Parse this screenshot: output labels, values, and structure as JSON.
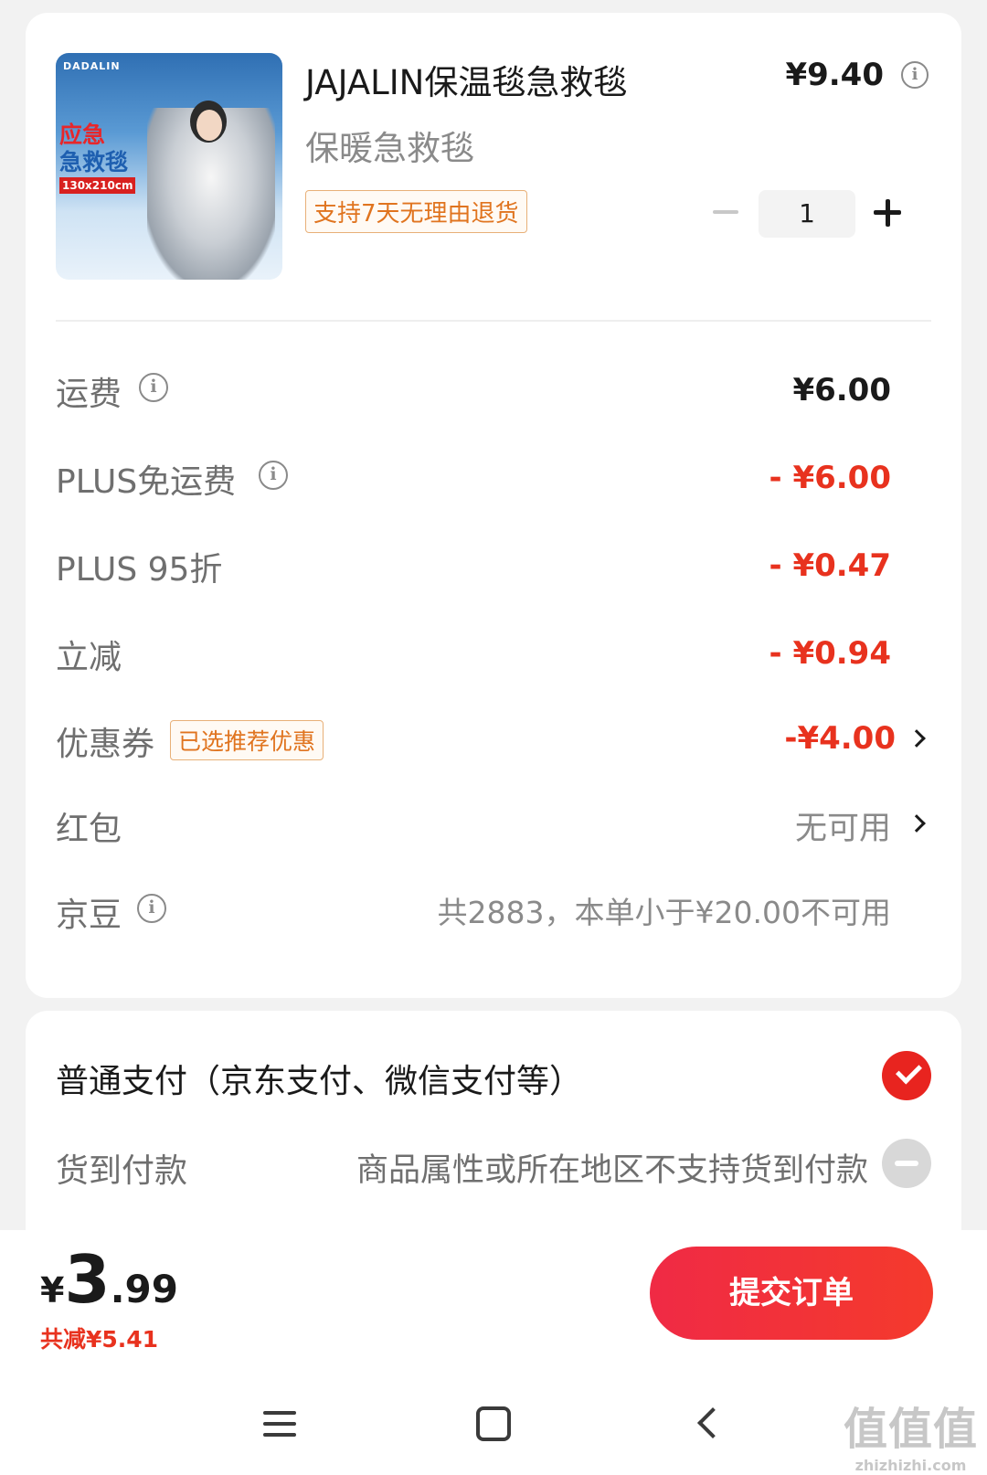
{
  "product": {
    "image_brand": "DADALIN",
    "image_text_1": "应急",
    "image_text_2": "急救毯",
    "image_size": "130x210cm",
    "title": "JAJALIN保温毯急救毯",
    "price": "¥9.40",
    "subtitle": "保暖急救毯",
    "return_badge": "支持7天无理由退货",
    "quantity": "1"
  },
  "fees": [
    {
      "label": "运费",
      "value": "¥6.00"
    },
    {
      "label": "PLUS免运费",
      "value": "- ¥6.00"
    },
    {
      "label": "PLUS 95折",
      "value": "- ¥0.47"
    },
    {
      "label": "立减",
      "value": "- ¥0.94"
    },
    {
      "label": "优惠券",
      "badge": "已选推荐优惠",
      "value": "-¥4.00"
    },
    {
      "label": "红包",
      "value": "无可用"
    },
    {
      "label": "京豆",
      "value": "共2883，本单小于¥20.00不可用"
    }
  ],
  "payment": {
    "normal": "普通支付（京东支付、微信支付等）",
    "cod": "货到付款",
    "cod_note": "商品属性或所在地区不支持货到付款"
  },
  "footer": {
    "currency": "¥",
    "total_int": "3",
    "total_dec": ".99",
    "saved": "共减¥5.41",
    "submit": "提交订单"
  },
  "watermark": {
    "big": "值值值",
    "small": "zhizhizhi.com"
  },
  "colors": {
    "accent_red": "#e8321e",
    "badge_orange": "#e0741f"
  }
}
